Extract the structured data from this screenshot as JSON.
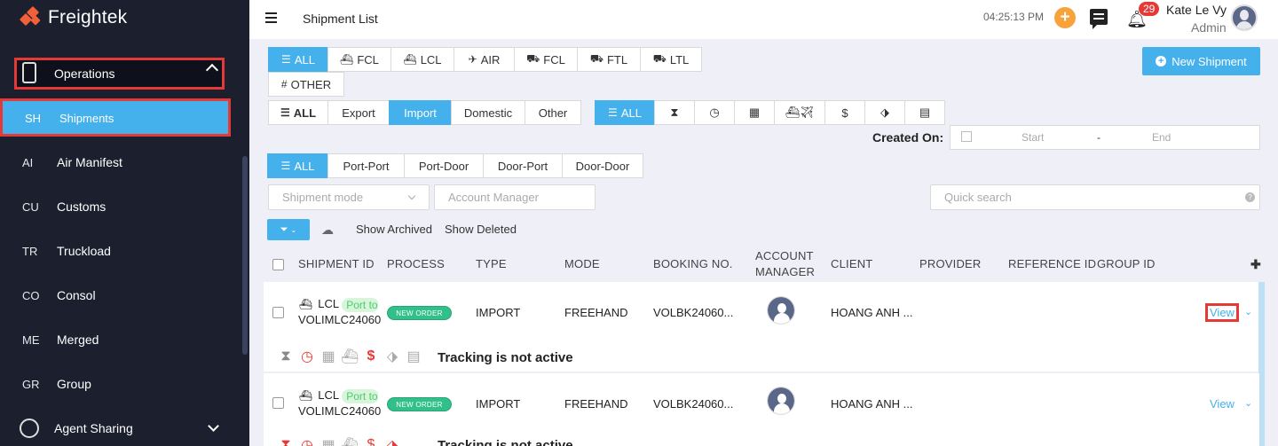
{
  "app": {
    "name": "Freightek"
  },
  "sidebar": {
    "group": {
      "label": "Operations",
      "chevron": "chevron-up-icon"
    },
    "items": [
      {
        "abbr": "SH",
        "label": "Shipments"
      },
      {
        "abbr": "AI",
        "label": "Air Manifest"
      },
      {
        "abbr": "CU",
        "label": "Customs"
      },
      {
        "abbr": "TR",
        "label": "Truckload"
      },
      {
        "abbr": "CO",
        "label": "Consol"
      },
      {
        "abbr": "ME",
        "label": "Merged"
      },
      {
        "abbr": "GR",
        "label": "Group"
      }
    ],
    "agent_sharing": {
      "label": "Agent Sharing"
    }
  },
  "header": {
    "title": "Shipment List",
    "clock": "04:25:13 PM",
    "plus": "+",
    "notification_count": "29",
    "user_name": "Kate Le Vy",
    "user_role": "Admin"
  },
  "mode_tabs": [
    {
      "label": "ALL",
      "icon": "list-icon"
    },
    {
      "label": "FCL",
      "icon": "ship-icon"
    },
    {
      "label": "LCL",
      "icon": "ship-icon"
    },
    {
      "label": "AIR",
      "icon": "plane-icon"
    },
    {
      "label": "FCL",
      "icon": "truck-icon"
    },
    {
      "label": "FTL",
      "icon": "truck-icon"
    },
    {
      "label": "LTL",
      "icon": "truck-icon"
    },
    {
      "label": "OTHER",
      "icon": "hash-icon"
    }
  ],
  "new_shipment": {
    "label": "New Shipment"
  },
  "direction_tabs": [
    "ALL",
    "Export",
    "Import",
    "Domestic",
    "Other"
  ],
  "status_tabs": {
    "all_label": "ALL"
  },
  "created_on": {
    "label": "Created On:",
    "start": "Start",
    "sep": "-",
    "end": "End"
  },
  "route_tabs": [
    "ALL",
    "Port-Port",
    "Port-Door",
    "Door-Port",
    "Door-Door"
  ],
  "filters": {
    "shipment_mode_placeholder": "Shipment mode",
    "account_manager_placeholder": "Account Manager",
    "quick_search_placeholder": "Quick search",
    "show_archived": "Show Archived",
    "show_deleted": "Show Deleted"
  },
  "table": {
    "headers": [
      "SHIPMENT ID",
      "PROCESS",
      "TYPE",
      "MODE",
      "BOOKING NO.",
      "ACCOUNT",
      "MANAGER",
      "CLIENT",
      "PROVIDER",
      "REFERENCE ID",
      "GROUP ID"
    ],
    "rows": [
      {
        "mode": "LCL",
        "route": "Port to Port",
        "id": "VOLIMLC24060",
        "process": "NEW ORDER",
        "type": "IMPORT",
        "transport": "FREEHAND",
        "booking": "VOLBK24060...",
        "client": "HOANG ANH ...",
        "view": "View",
        "tracking": "Tracking is not active"
      },
      {
        "mode": "LCL",
        "route": "Port to Port",
        "id": "VOLIMLC24060",
        "process": "NEW ORDER",
        "type": "IMPORT",
        "transport": "FREEHAND",
        "booking": "VOLBK24060...",
        "client": "HOANG ANH ...",
        "view": "View",
        "tracking": "Tracking is not active"
      }
    ]
  },
  "colors": {
    "accent": "#45b1ec",
    "sidebar": "#1b1f2e",
    "highlight": "#e53935",
    "brand": "#f2603a"
  }
}
